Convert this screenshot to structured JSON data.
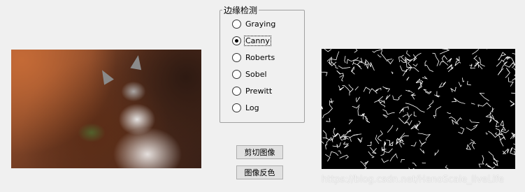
{
  "panel": {
    "legend": "边缘检测",
    "options": [
      {
        "label": "Graying",
        "checked": false
      },
      {
        "label": "Canny",
        "checked": true
      },
      {
        "label": "Roberts",
        "checked": false
      },
      {
        "label": "Sobel",
        "checked": false
      },
      {
        "label": "Prewitt",
        "checked": false
      },
      {
        "label": "Log",
        "checked": false
      }
    ]
  },
  "buttons": {
    "crop_label": "剪切图像",
    "invert_label": "图像反色"
  },
  "watermark": "https://blog.csdn.net/HanoScale_liveLife",
  "colors": {
    "window_bg": "#f0f0f0",
    "edge_bg": "#000000",
    "edge_stroke": "#ffffff"
  }
}
